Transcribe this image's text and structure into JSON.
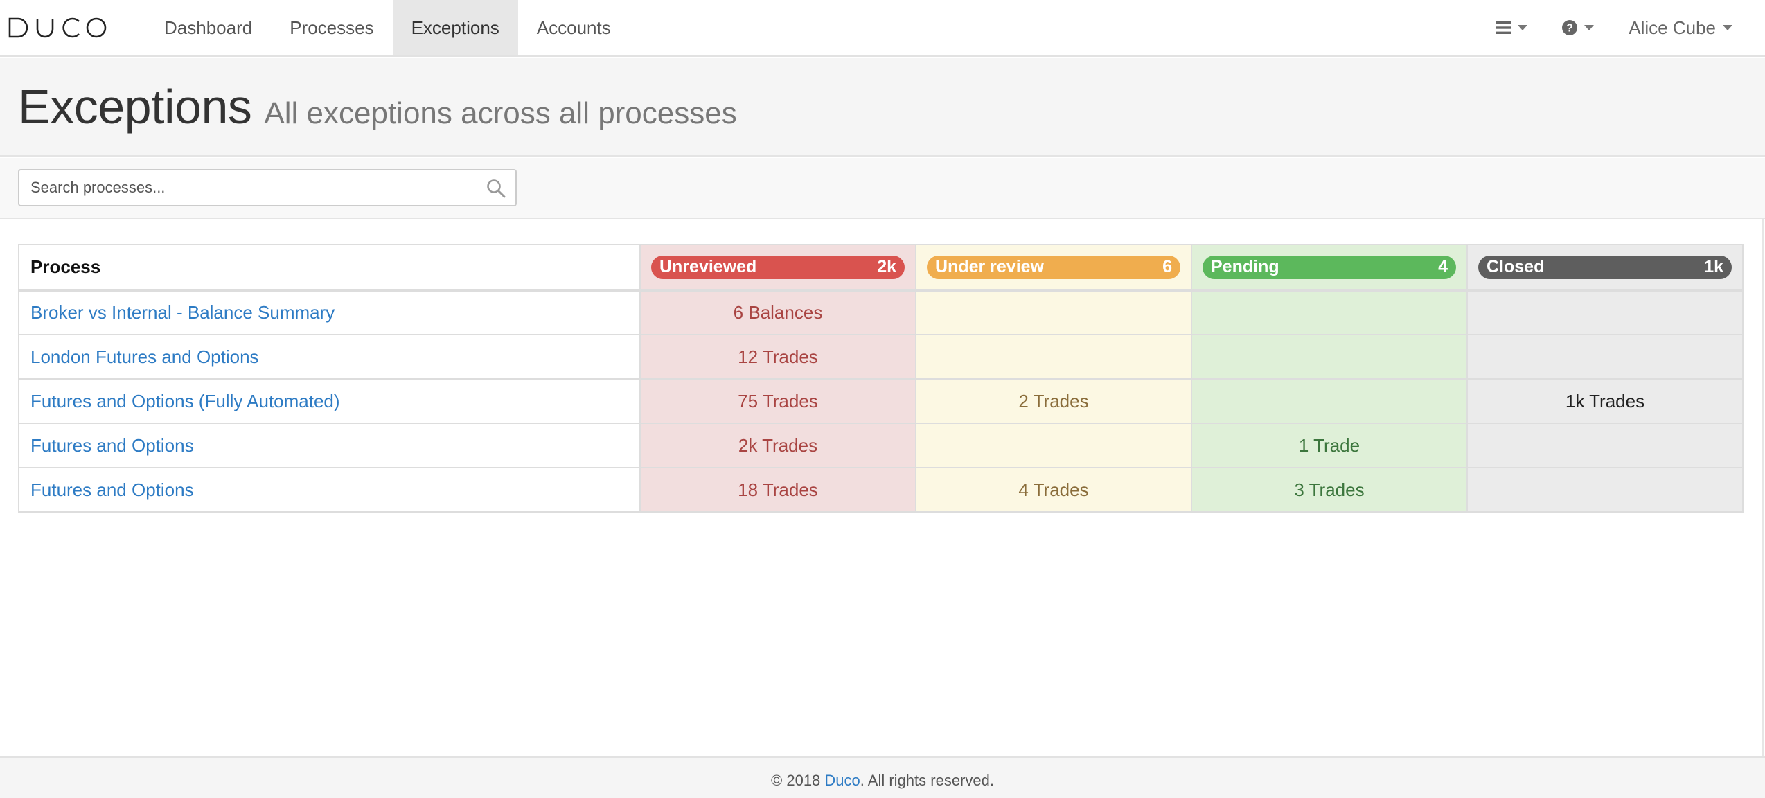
{
  "navbar": {
    "logo_text": "DUCO",
    "items": [
      {
        "label": "Dashboard",
        "active": false
      },
      {
        "label": "Processes",
        "active": false
      },
      {
        "label": "Exceptions",
        "active": true
      },
      {
        "label": "Accounts",
        "active": false
      }
    ],
    "right": {
      "menu_icon": "hamburger-icon",
      "help_icon": "question-circle-icon",
      "user_name": "Alice Cube"
    }
  },
  "header": {
    "title": "Exceptions",
    "subtitle": "All exceptions across all processes"
  },
  "search": {
    "placeholder": "Search processes...",
    "value": "",
    "icon": "search-icon"
  },
  "table": {
    "process_header": "Process",
    "statuses": [
      {
        "key": "unreviewed",
        "label": "Unreviewed",
        "count": "2k",
        "color": "#d9534f"
      },
      {
        "key": "review",
        "label": "Under review",
        "count": "6",
        "color": "#f0ad4e"
      },
      {
        "key": "pending",
        "label": "Pending",
        "count": "4",
        "color": "#5cb85c"
      },
      {
        "key": "closed",
        "label": "Closed",
        "count": "1k",
        "color": "#5e5e5e"
      }
    ],
    "rows": [
      {
        "process": "Broker vs Internal - Balance Summary",
        "unreviewed": "6 Balances",
        "review": "",
        "pending": "",
        "closed": ""
      },
      {
        "process": "London Futures and Options",
        "unreviewed": "12 Trades",
        "review": "",
        "pending": "",
        "closed": ""
      },
      {
        "process": "Futures and Options (Fully Automated)",
        "unreviewed": "75 Trades",
        "review": "2 Trades",
        "pending": "",
        "closed": "1k Trades"
      },
      {
        "process": "Futures and Options",
        "unreviewed": "2k Trades",
        "review": "",
        "pending": "1 Trade",
        "closed": ""
      },
      {
        "process": "Futures and Options",
        "unreviewed": "18 Trades",
        "review": "4 Trades",
        "pending": "3 Trades",
        "closed": ""
      }
    ]
  },
  "footer": {
    "copyright": "© 2018",
    "brand_link": "Duco",
    "rights": ". All rights reserved."
  }
}
